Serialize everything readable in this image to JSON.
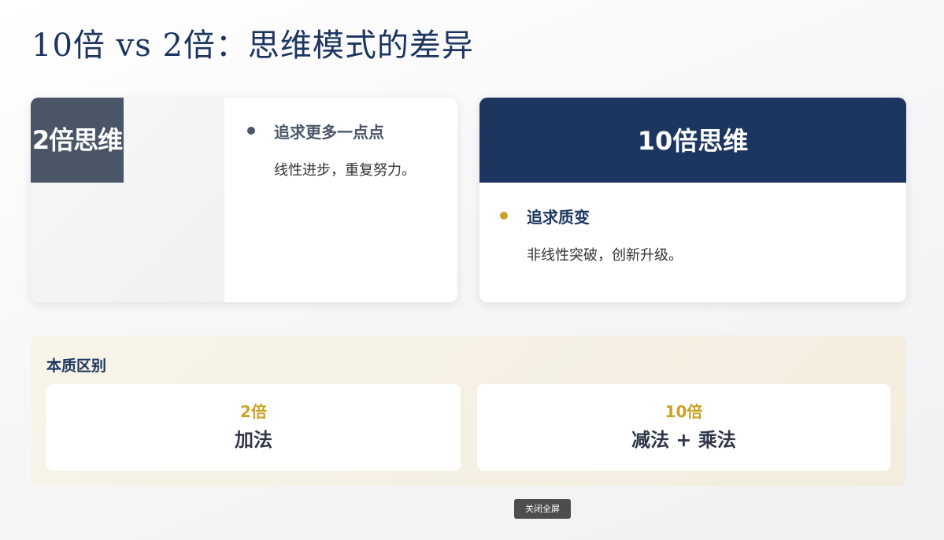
{
  "page": {
    "title": "10倍 vs 2倍：思维模式的差异"
  },
  "cards": {
    "two_x": {
      "header": "2倍思维",
      "bullet_title": "追求更多一点点",
      "bullet_desc": "线性进步，重复努力。"
    },
    "ten_x": {
      "header": "10倍思维",
      "bullet_title": "追求质变",
      "bullet_desc": "非线性突破，创新升级。"
    }
  },
  "essence": {
    "title": "本质区别",
    "items": [
      {
        "label": "2倍",
        "value": "加法"
      },
      {
        "label": "10倍",
        "value": "减法 + 乘法"
      }
    ]
  },
  "controls": {
    "exit_fullscreen": "关闭全屏"
  },
  "colors": {
    "navy": "#1c3660",
    "slate": "#4a5568",
    "gold": "#c9a227"
  }
}
